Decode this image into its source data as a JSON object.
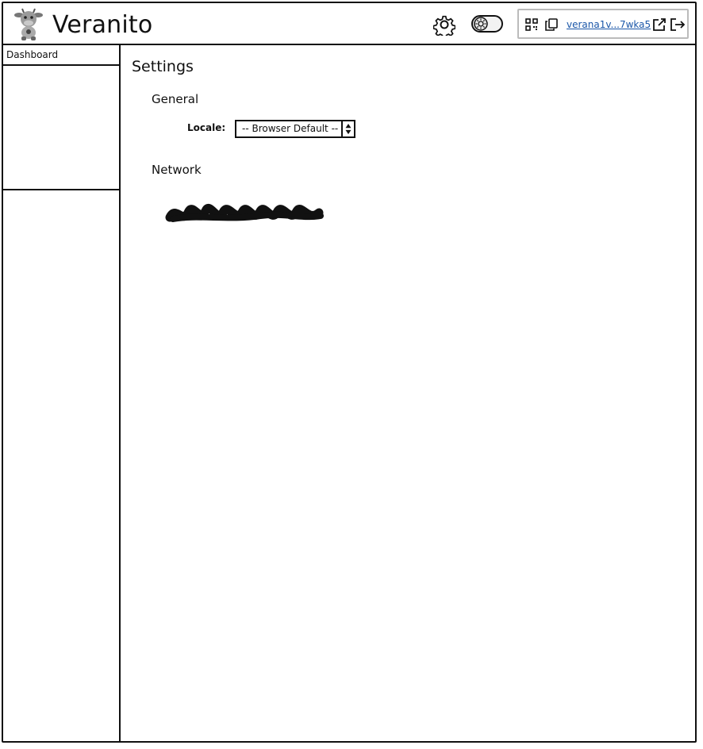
{
  "header": {
    "app_title": "Veranito",
    "logo_icon": "cow-mascot-logo",
    "settings_icon": "gear-icon",
    "theme_toggle_icon": "theme-toggle-icon",
    "account": {
      "address": "verana1v...7wka5",
      "qr_icon": "qr-code-icon",
      "copy_icon": "copy-icon",
      "external_icon": "external-link-icon",
      "logout_icon": "logout-icon"
    }
  },
  "sidebar": {
    "items": [
      {
        "label": "Dashboard"
      }
    ]
  },
  "main": {
    "title": "Settings",
    "general": {
      "heading": "General",
      "locale_label": "Locale:",
      "locale_value": "-- Browser Default --"
    },
    "network": {
      "heading": "Network"
    }
  }
}
